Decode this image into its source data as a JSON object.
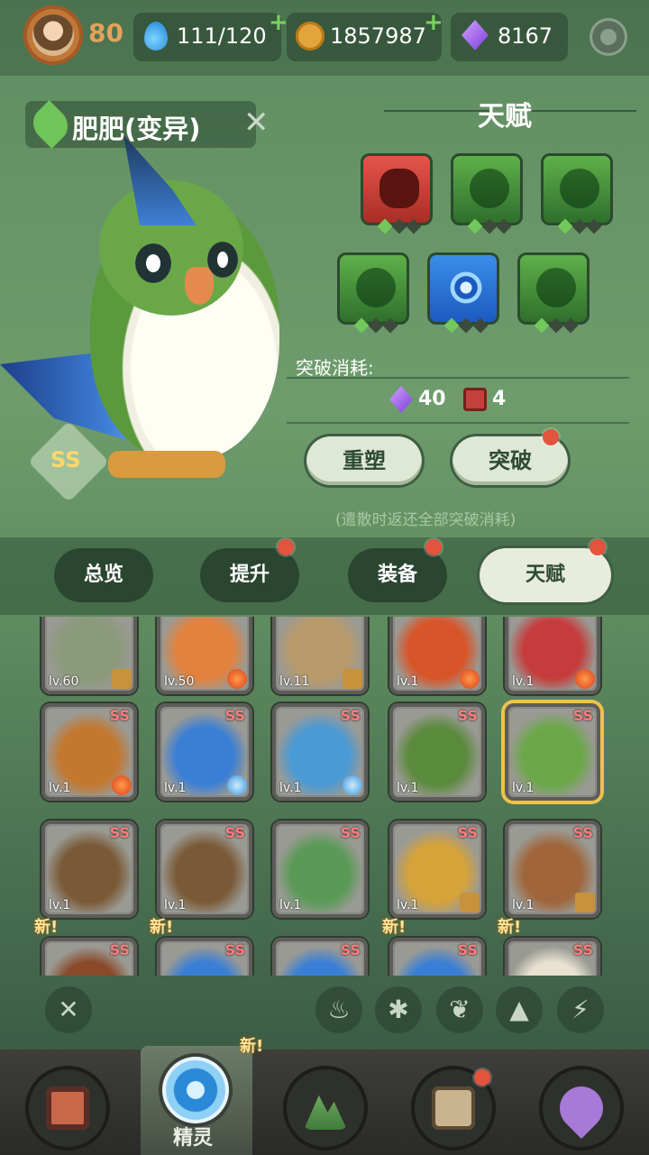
{
  "player": {
    "level": "80",
    "stamina": "111/120",
    "coins": "1857987",
    "gems": "8167"
  },
  "pet": {
    "name": "肥肥(变异)",
    "rank": "SS"
  },
  "talent": {
    "title": "天赋",
    "cards": [
      {
        "type": "red",
        "icon": "fang-icon",
        "stars_on": 1
      },
      {
        "type": "green",
        "icon": "leaf-claw-icon",
        "stars_on": 1
      },
      {
        "type": "green",
        "icon": "leaf-icon",
        "stars_on": 1
      },
      {
        "type": "green",
        "icon": "leaf-claw-icon",
        "stars_on": 1
      },
      {
        "type": "blue",
        "icon": "vortex-icon",
        "stars_on": 1
      },
      {
        "type": "green",
        "icon": "slash-icon",
        "stars_on": 1
      }
    ],
    "cost_label": "突破消耗:",
    "cost_gems": "40",
    "cost_books": "4",
    "reset_label": "重塑",
    "break_label": "突破",
    "notice": "(遣散时返还全部突破消耗)"
  },
  "tabs": [
    {
      "label": "总览",
      "dot": false
    },
    {
      "label": "提升",
      "dot": true
    },
    {
      "label": "装备",
      "dot": true
    },
    {
      "label": "天赋",
      "dot": true,
      "active": true
    }
  ],
  "pets": [
    {
      "lv": "lv.60",
      "element": "earth",
      "color": "#8b9a7a"
    },
    {
      "lv": "lv.50",
      "element": "fire",
      "color": "#e2823e"
    },
    {
      "lv": "lv.11",
      "element": "earth",
      "color": "#b99a6a"
    },
    {
      "lv": "lv.1",
      "element": "fire",
      "color": "#d8552a"
    },
    {
      "lv": "lv.1",
      "element": "fire",
      "color": "#c63b3b"
    },
    {
      "lv": "lv.1",
      "rank": "SS",
      "element": "fire",
      "color": "#c4772f"
    },
    {
      "lv": "lv.1",
      "rank": "SS",
      "element": "ice",
      "color": "#3a7fd6"
    },
    {
      "lv": "lv.1",
      "rank": "SS",
      "element": "ice",
      "color": "#4a9ad6"
    },
    {
      "lv": "lv.1",
      "rank": "SS",
      "element": "leaf",
      "color": "#5a8a3c"
    },
    {
      "lv": "lv.1",
      "rank": "SS",
      "element": "leaf",
      "color": "#6aa847",
      "selected": true
    },
    {
      "lv": "lv.1",
      "rank": "SS",
      "element": "leaf",
      "color": "#7a5a36"
    },
    {
      "lv": "lv.1",
      "rank": "SS",
      "element": "leaf",
      "color": "#7a5a36"
    },
    {
      "lv": "lv.1",
      "rank": "SS",
      "element": "leaf",
      "color": "#5a9a56"
    },
    {
      "lv": "lv.1",
      "rank": "SS",
      "element": "earth",
      "color": "#d6a23a"
    },
    {
      "lv": "lv.1",
      "rank": "SS",
      "element": "earth",
      "color": "#a0653a"
    },
    {
      "lv": "",
      "rank": "SS",
      "new": "新!",
      "element": "",
      "color": "#8a4a2a"
    },
    {
      "lv": "",
      "rank": "SS",
      "new": "新!",
      "element": "",
      "color": "#3a7fd6"
    },
    {
      "lv": "",
      "rank": "SS",
      "new": "",
      "element": "",
      "color": "#3a7fd6"
    },
    {
      "lv": "",
      "rank": "SS",
      "new": "新!",
      "element": "",
      "color": "#3a7fd6"
    },
    {
      "lv": "",
      "rank": "SS",
      "new": "新!",
      "element": "",
      "color": "#e8e2d0"
    }
  ],
  "filters": [
    "clear-filter-icon",
    "fire-filter-icon",
    "ice-filter-icon",
    "leaf-filter-icon",
    "earth-filter-icon",
    "lightning-filter-icon"
  ],
  "filter_glyphs": [
    "✕",
    "♨",
    "✱",
    "❦",
    "▲",
    "⚡"
  ],
  "nav": {
    "spirit_label": "精灵",
    "new_badge": "新!"
  }
}
